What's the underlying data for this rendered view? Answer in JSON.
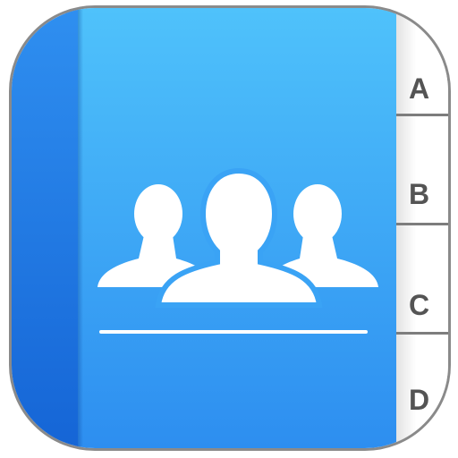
{
  "icon": {
    "name": "contacts-app-icon",
    "colors": {
      "cover_top": "#4fc2fb",
      "cover_bottom": "#2d8ef0",
      "spine": "#1565d6",
      "tab_text": "#545454"
    }
  },
  "tabs": [
    {
      "label": "A"
    },
    {
      "label": "B"
    },
    {
      "label": "C"
    },
    {
      "label": "D"
    }
  ]
}
